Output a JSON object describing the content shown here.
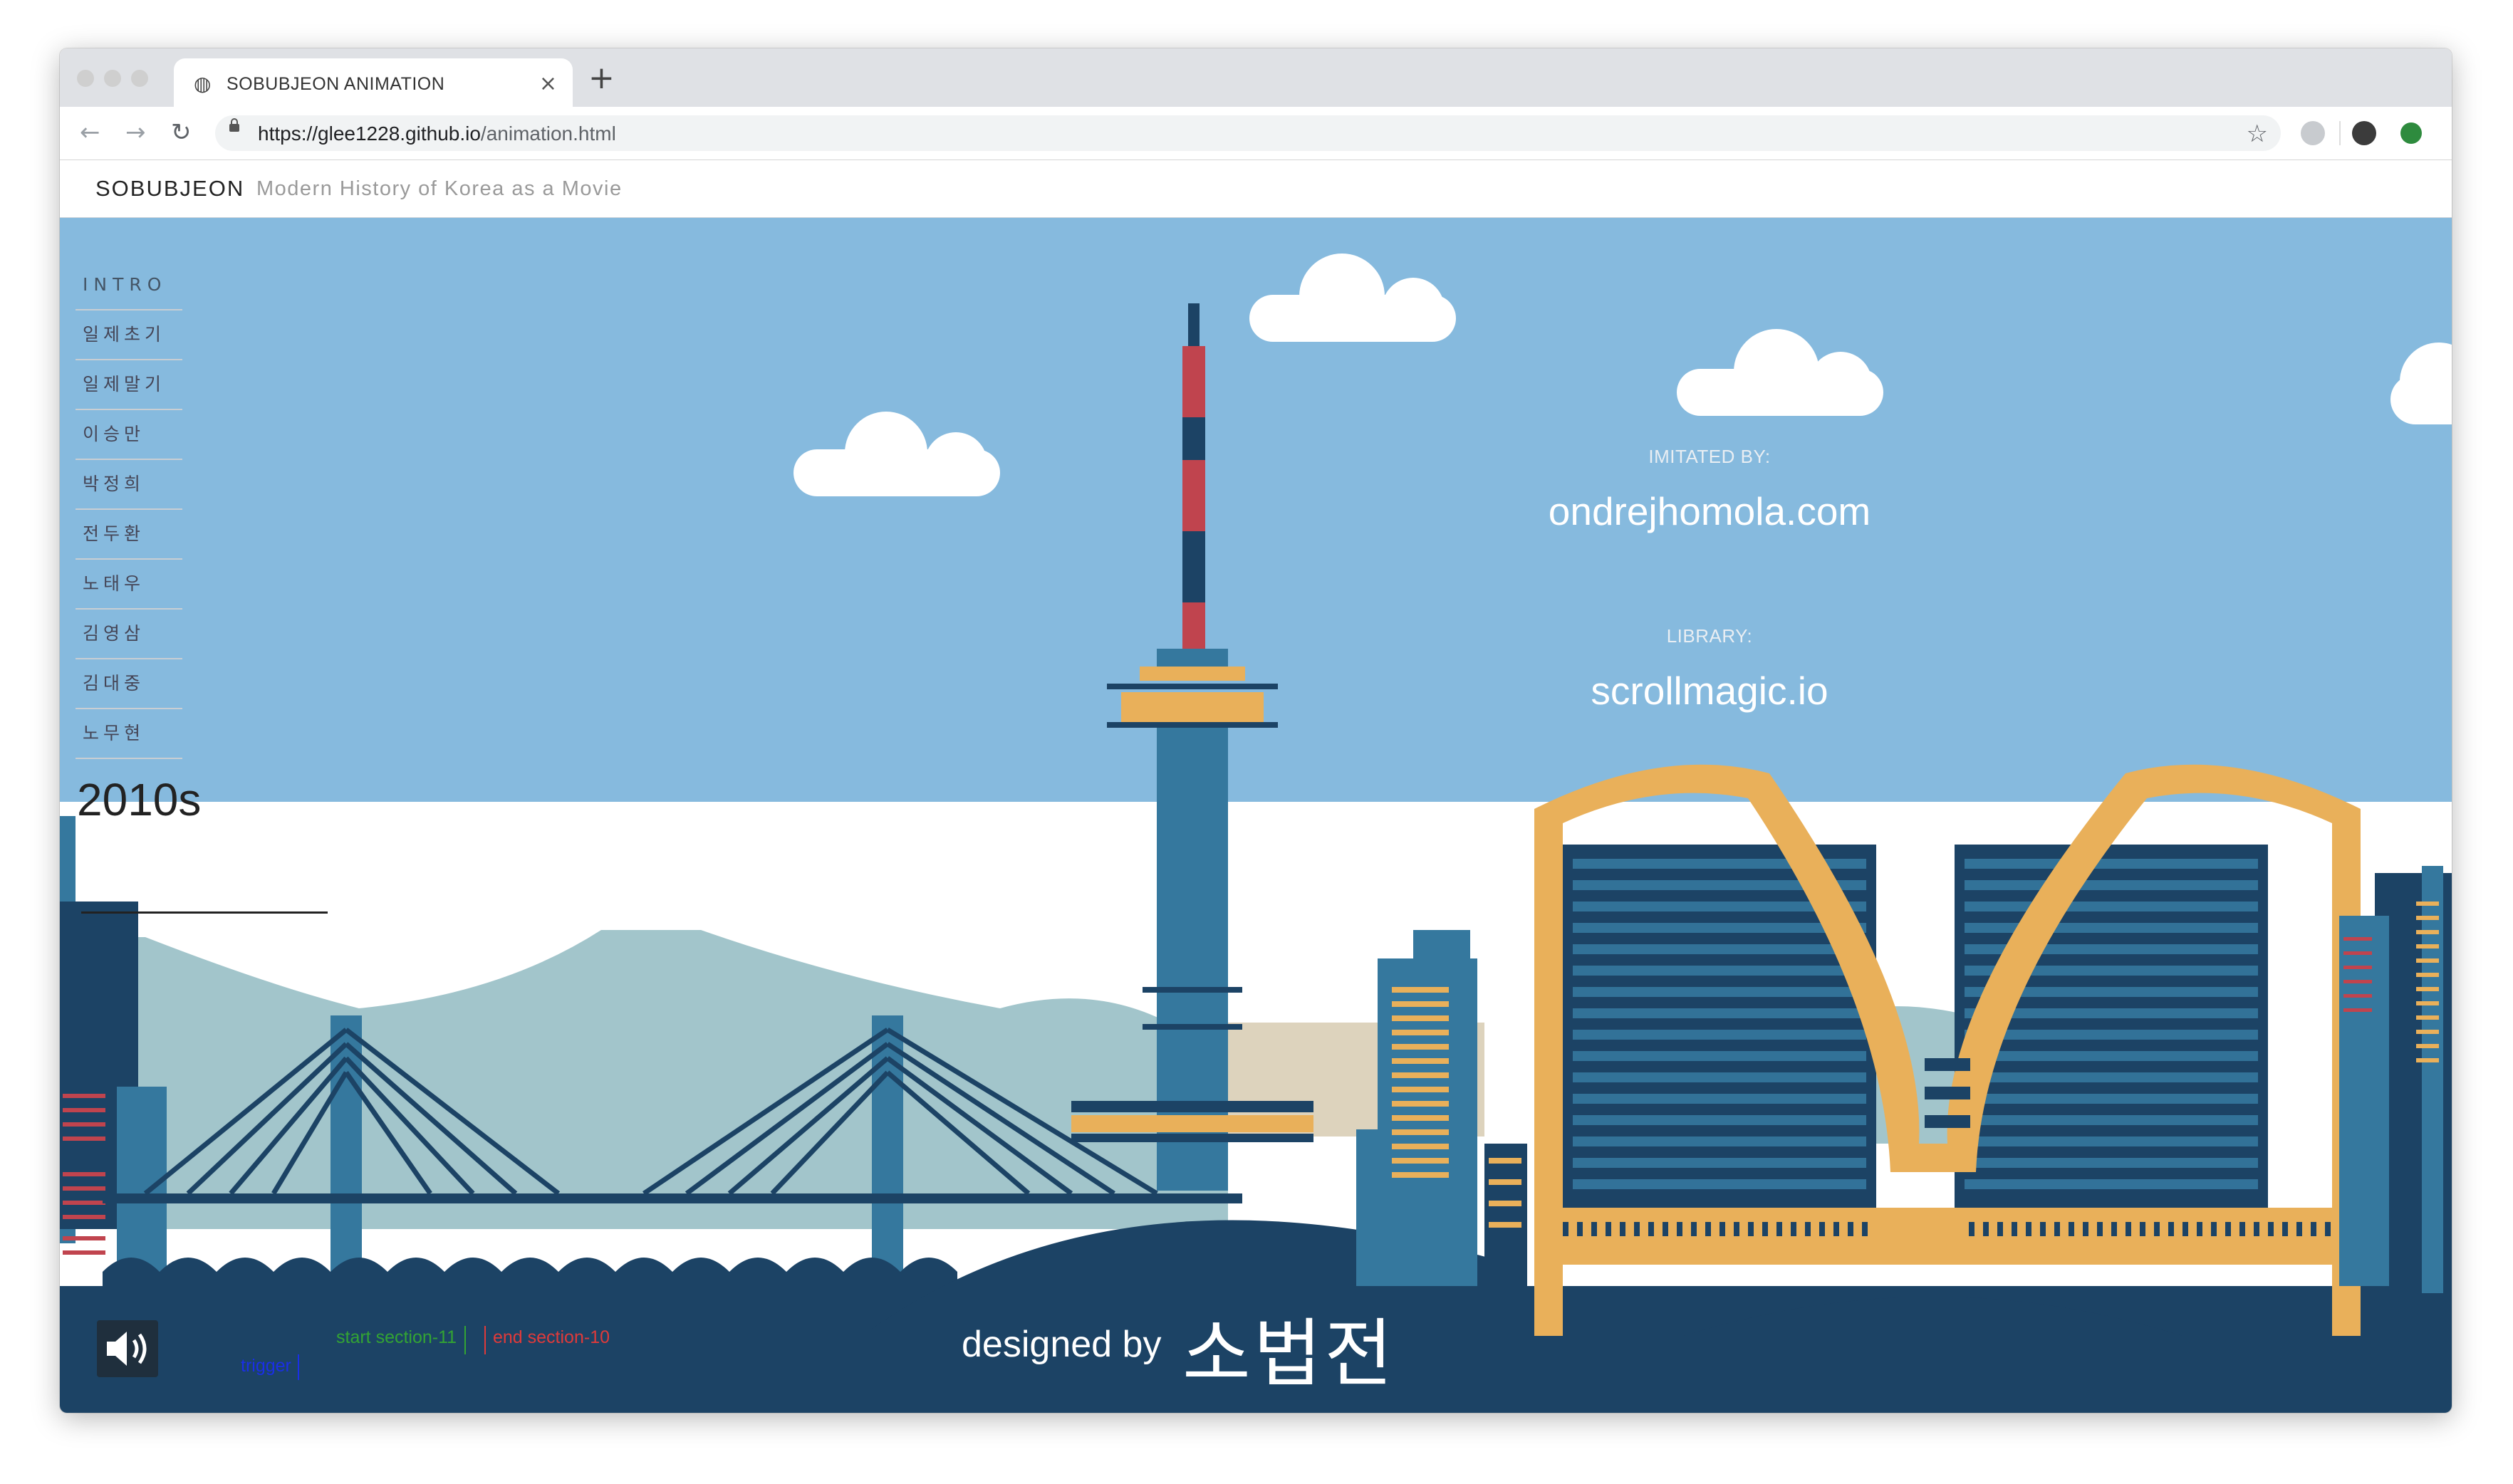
{
  "browser": {
    "tab_title": "SOBUBJEON ANIMATION",
    "tab_close": "×",
    "new_tab": "+",
    "url_host": "https://glee1228.github.io",
    "url_path": "/animation.html",
    "back": "←",
    "forward": "→",
    "reload": "↻",
    "star": "☆"
  },
  "site": {
    "brand": "SOBUBJEON",
    "tagline": "Modern History of Korea as a Movie"
  },
  "menu": {
    "items": [
      {
        "label": "INTRO"
      },
      {
        "label": "일제초기"
      },
      {
        "label": "일제말기"
      },
      {
        "label": "이승만"
      },
      {
        "label": "박정희"
      },
      {
        "label": "전두환"
      },
      {
        "label": "노태우"
      },
      {
        "label": "김영삼"
      },
      {
        "label": "김대중"
      },
      {
        "label": "노무현"
      }
    ]
  },
  "era": {
    "title": "2010s"
  },
  "credits": {
    "imitated_label": "IMITATED BY:",
    "imitated_value": "ondrejhomola.com",
    "library_label": "LIBRARY:",
    "library_value": "scrollmagic.io"
  },
  "footer": {
    "designed_by": "designed by",
    "designer": "소법전"
  },
  "debug": {
    "start": "start section-11",
    "end": "end section-10",
    "trigger": "trigger"
  },
  "colors": {
    "sky": "#86bade",
    "navy": "#1c4365",
    "tower_blue": "#35789e",
    "gold": "#e9b05a",
    "red": "#c0444e",
    "mountain": "#a2c5cb",
    "sand": "#ddd3bd",
    "debug_green": "#33a433",
    "debug_red": "#e03a3a",
    "debug_blue": "#1a2fe6"
  },
  "icons": {
    "sound": "speaker-icon",
    "favicon": "globe-icon",
    "lock": "lock-icon"
  }
}
